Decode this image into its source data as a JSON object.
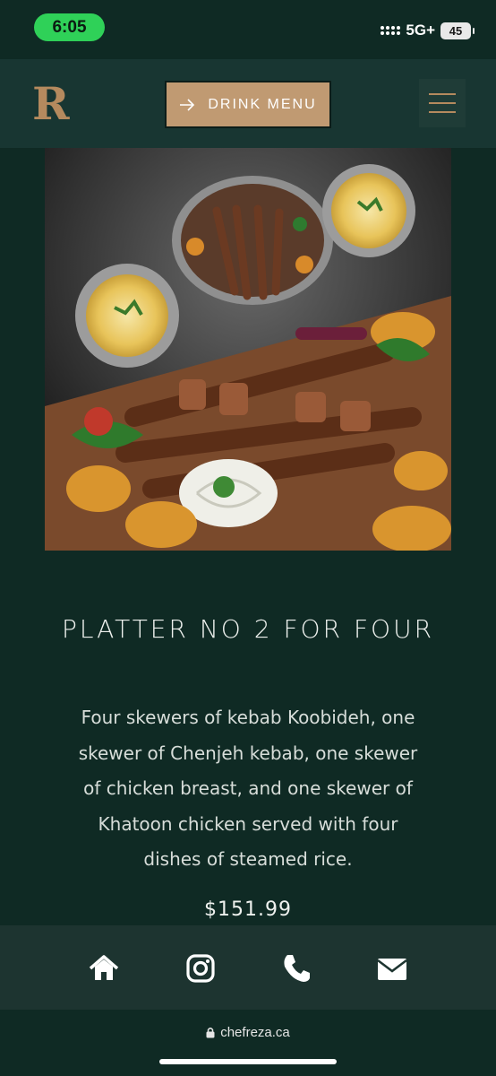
{
  "status_bar": {
    "time": "6:05",
    "network": "5G+",
    "battery": "45"
  },
  "header": {
    "logo_letter": "R",
    "drink_menu_label": "DRINK MENU",
    "arrow_icon": "arrow-right-icon",
    "menu_icon": "hamburger-icon"
  },
  "item": {
    "image_alt": "platter-photo",
    "title": "PLATTER NO 2 FOR FOUR",
    "description": "Four skewers of kebab Koobideh, one skewer of Chenjeh kebab, one skewer of chicken breast, and one skewer of Khatoon chicken served with four dishes of steamed rice.",
    "price": "$151.99"
  },
  "bottom_nav": {
    "icons": [
      "home-icon",
      "instagram-icon",
      "phone-icon",
      "mail-icon"
    ]
  },
  "browser": {
    "url": "chefreza.ca"
  },
  "colors": {
    "background": "#0f2a24",
    "header": "#183632",
    "accent": "#c09a72",
    "logo": "#b58a5e"
  }
}
